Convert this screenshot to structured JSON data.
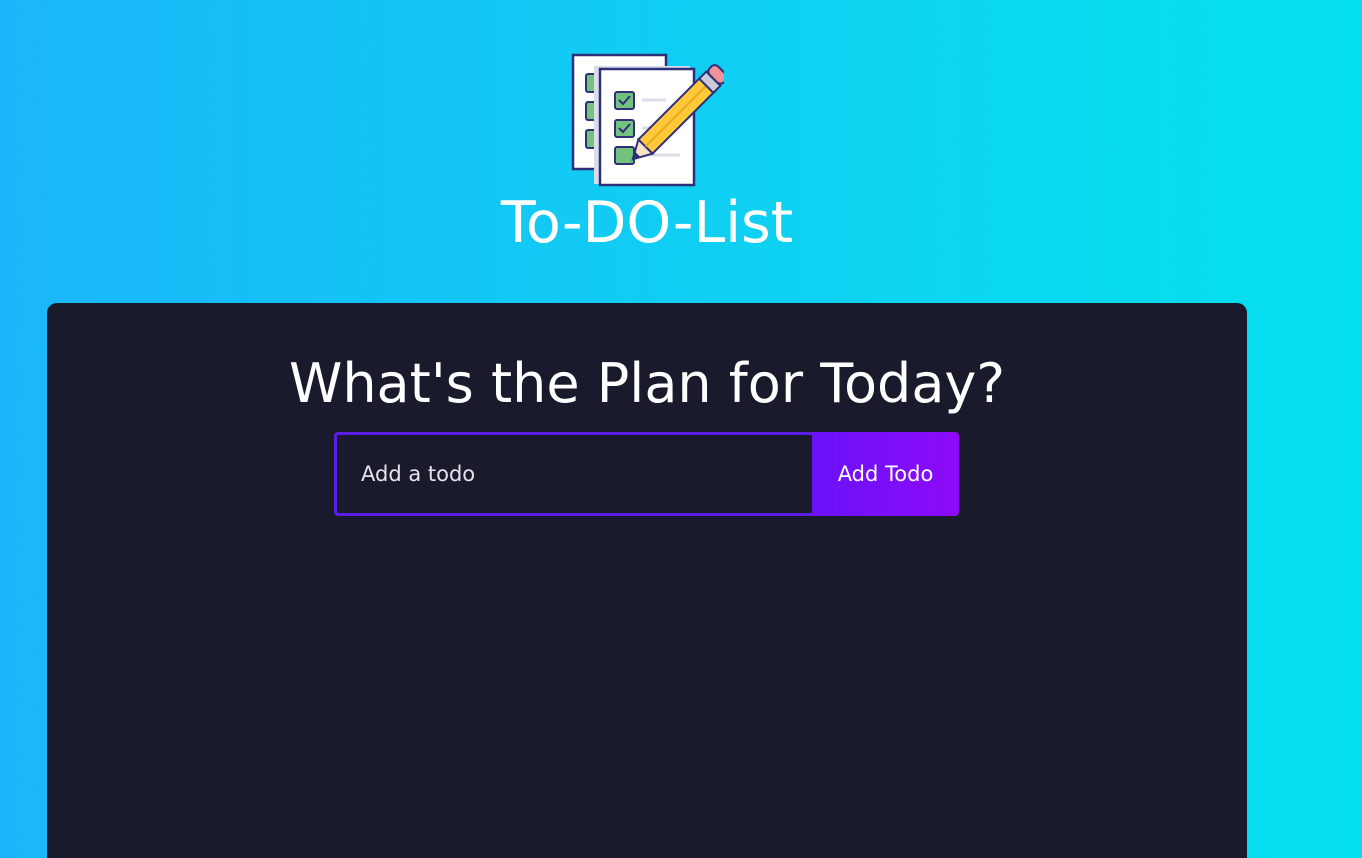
{
  "header": {
    "logo_icon": "checklist-with-pencil-icon",
    "title": "To-DO-List"
  },
  "card": {
    "heading": "What's the Plan for Today?",
    "form": {
      "input_placeholder": "Add a todo",
      "input_value": "",
      "button_label": "Add Todo"
    },
    "todos": []
  },
  "colors": {
    "background_start": "#1ab6f9",
    "background_end": "#04e1ee",
    "card_background": "#191a2b",
    "input_border": "#5b1ee6",
    "button_start": "#6a12f8",
    "button_end": "#8d0af8"
  }
}
